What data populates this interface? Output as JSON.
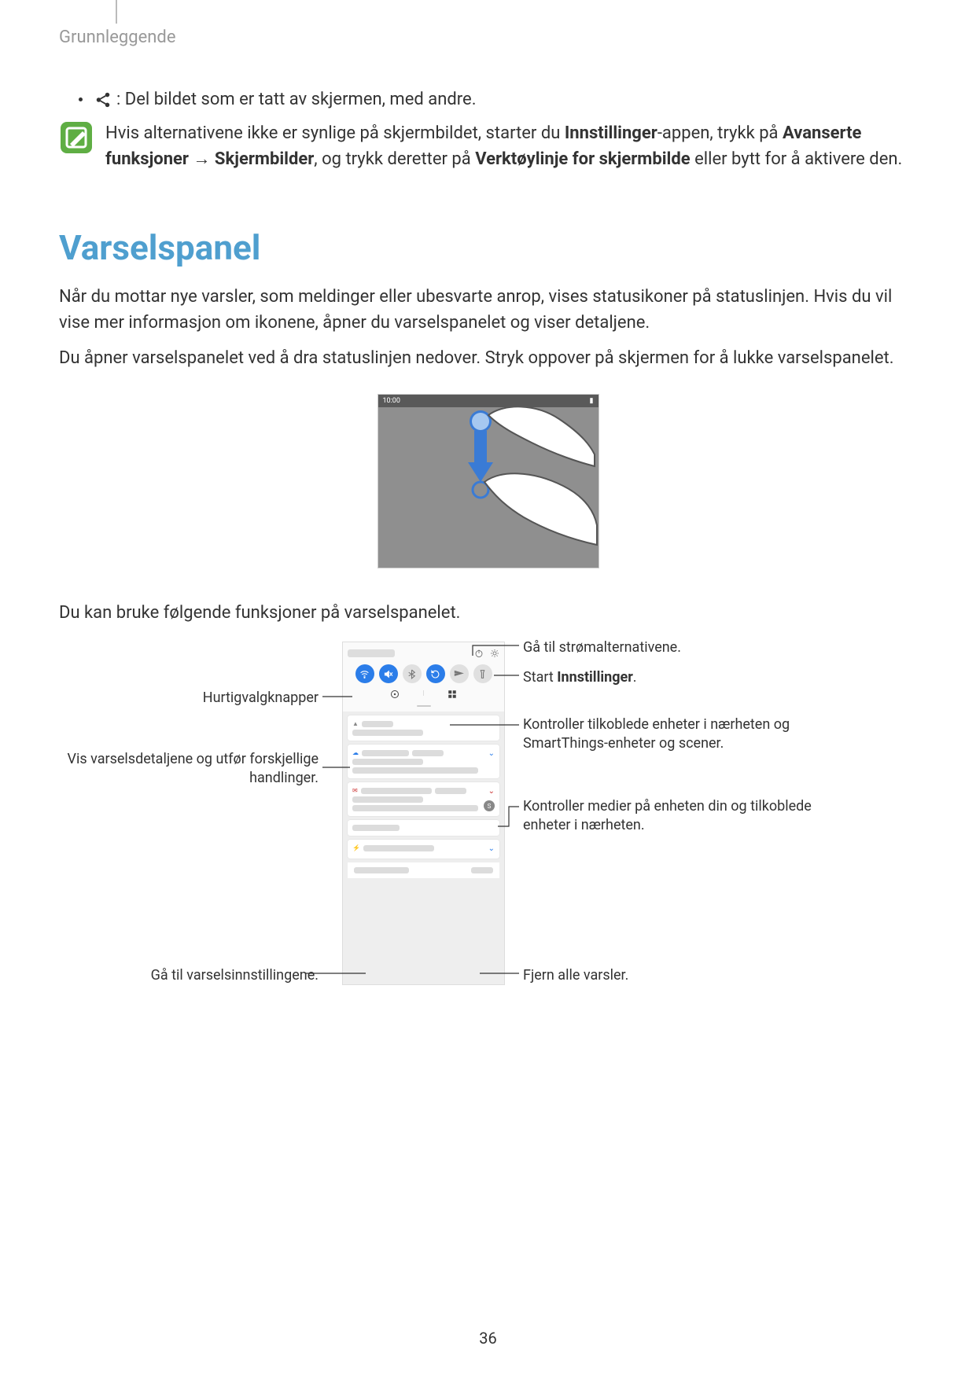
{
  "chapter": "Grunnleggende",
  "share_bullet_text": ": Del bildet som er tatt av skjermen, med andre.",
  "note_pre": "Hvis alternativene ikke er synlige på skjermbildet, starter du ",
  "note_bold1": "Innstillinger",
  "note_mid1": "-appen, trykk på ",
  "note_bold2": "Avanserte funksjoner",
  "note_arrow": " → ",
  "note_bold3": "Skjermbilder",
  "note_mid2": ", og trykk deretter på ",
  "note_bold4": "Verktøylinje for skjermbilde",
  "note_end": " eller bytt for å aktivere den.",
  "section_title": "Varselspanel",
  "para1": "Når du mottar nye varsler, som meldinger eller ubesvarte anrop, vises statusikoner på statuslinjen. Hvis du vil vise mer informasjon om ikonene, åpner du varselspanelet og viser detaljene.",
  "para2": "Du åpner varselspanelet ved å dra statuslinjen nedover. Stryk oppover på skjermen for å lukke varselspanelet.",
  "swipe_time": "10:00",
  "para3": "Du kan bruke følgende funksjoner på varselspanelet.",
  "callouts": {
    "power": "Gå til strømalternativene.",
    "settings_pre": "Start ",
    "settings_bold": "Innstillinger",
    "settings_post": ".",
    "quick": "Hurtigvalgknapper",
    "details": "Vis varselsdetaljene og utfør forskjellige handlinger.",
    "devices": "Kontroller tilkoblede enheter i nærheten og SmartThings-enheter og scener.",
    "media": "Kontroller medier på enheten din og tilkoblede enheter i nærheten.",
    "notif_settings": "Gå til varselsinnstillingene.",
    "clear": "Fjern alle varsler."
  },
  "page_number": "36"
}
